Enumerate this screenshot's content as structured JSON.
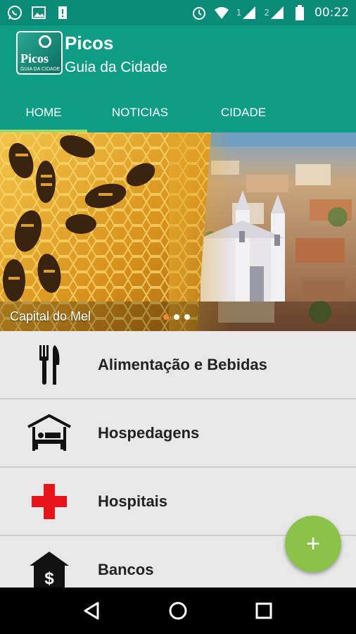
{
  "status_bar": {
    "time": "00:22",
    "sim1_label": "1",
    "sim2_label": "2",
    "icons": [
      "whatsapp-icon",
      "image-icon",
      "notification-icon",
      "alarm-icon",
      "wifi-icon",
      "signal-icon",
      "signal-icon",
      "battery-icon"
    ]
  },
  "app": {
    "title": "Picos",
    "subtitle": "Guia da Cidade",
    "logo_text": "Picos",
    "logo_sub": "GUIA DA CIDADE"
  },
  "tabs": [
    {
      "label": "HOME",
      "active": true
    },
    {
      "label": "NOTICIAS",
      "active": false
    },
    {
      "label": "CIDADE",
      "active": false
    }
  ],
  "banner": {
    "caption": "Capital do Mel",
    "slide_count": 3,
    "active_slide": 0
  },
  "categories": [
    {
      "label": "Alimentação e Bebidas",
      "icon": "fork-knife-icon"
    },
    {
      "label": "Hospedagens",
      "icon": "hotel-bed-icon"
    },
    {
      "label": "Hospitais",
      "icon": "red-cross-icon"
    },
    {
      "label": "Bancos",
      "icon": "bank-icon"
    }
  ],
  "fab": {
    "label": "+"
  },
  "colors": {
    "status_bar": "#0a8a78",
    "app_bar": "#0f9c87",
    "tab_indicator": "#9dd86b",
    "fab": "#8bc34a",
    "cross": "#e8141b"
  }
}
